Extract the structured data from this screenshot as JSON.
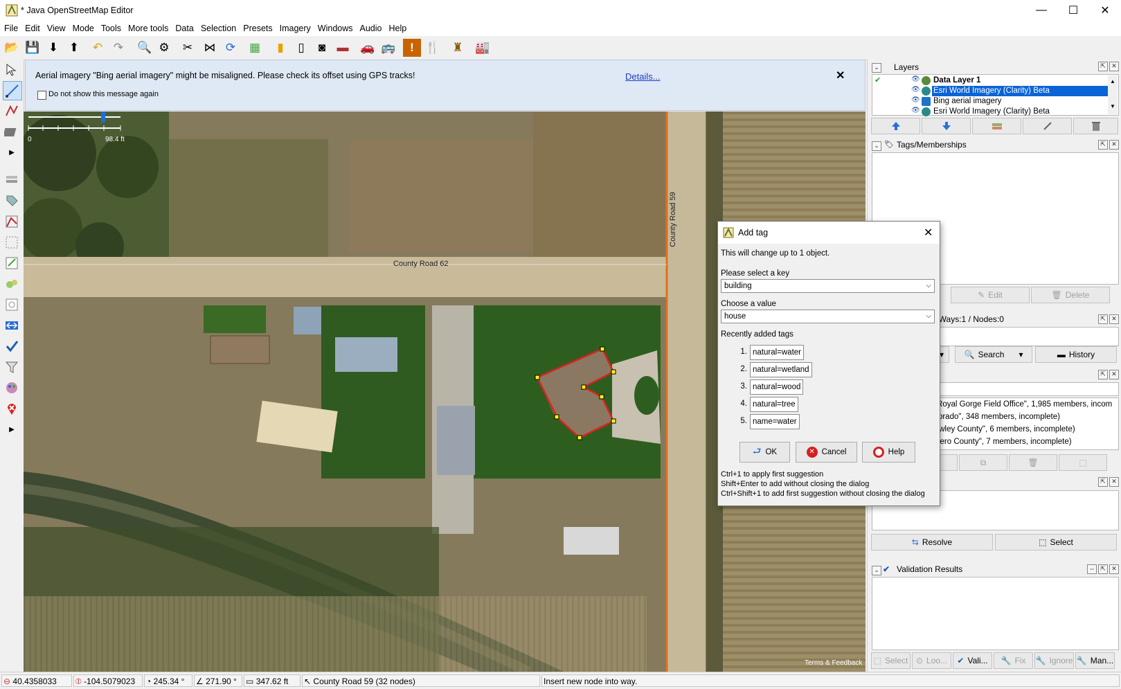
{
  "window": {
    "title": "* Java OpenStreetMap Editor",
    "controls": {
      "minimize": "—",
      "maximize": "☐",
      "close": "✕"
    }
  },
  "menu": [
    "File",
    "Edit",
    "View",
    "Mode",
    "Tools",
    "More tools",
    "Data",
    "Selection",
    "Presets",
    "Imagery",
    "Windows",
    "Audio",
    "Help"
  ],
  "toolbar_icons": [
    "open-file-icon",
    "save-icon",
    "download-icon",
    "upload-icon",
    "undo-icon",
    "redo-icon",
    "zoom-icon",
    "preferences-icon",
    "split-way-icon",
    "combine-icon",
    "update-icon",
    "wireframe-icon",
    "preset-traffic-icon",
    "preset-pole-icon",
    "preset-signal-icon",
    "preset-barrier-icon",
    "preset-car-icon",
    "preset-bus-icon",
    "preset-warning-icon",
    "preset-restaurant-icon",
    "preset-castle-icon",
    "preset-industry-icon"
  ],
  "notification": {
    "message": "Aerial imagery \"Bing aerial imagery\" might be misaligned. Please check its offset using GPS tracks!",
    "details_link": "Details...",
    "checkbox_label": "Do not show this message again",
    "close": "✕"
  },
  "map": {
    "scale_start": "0",
    "scale_end": "98.4 ft",
    "road_label_horizontal": "County Road 62",
    "road_label_vertical": "County Road 59",
    "attribution": "Terms & Feedback"
  },
  "colors": {
    "selection_way": "#e02020",
    "node": "#ffff00",
    "road_line": "#e0701c",
    "layer_selected": "#0a64d6"
  },
  "layers_panel": {
    "title": "Layers",
    "items": [
      {
        "name": "Data Layer 1",
        "bold": true,
        "selected": false
      },
      {
        "name": "Esri World Imagery (Clarity) Beta",
        "bold": false,
        "selected": true
      },
      {
        "name": "Bing aerial imagery",
        "bold": false,
        "selected": false
      },
      {
        "name": "Esri World Imagery (Clarity) Beta",
        "bold": false,
        "selected": false
      }
    ]
  },
  "tags_panel": {
    "title": "Tags/Memberships",
    "edit_label": "Edit",
    "delete_label": "Delete"
  },
  "selection_panel": {
    "title_partial": "/ Ways:1 / Nodes:0",
    "search_label": "Search",
    "history_label": "History"
  },
  "relations_panel": {
    "title_partial": "3",
    "items": [
      "- Royal Gorge Field Office\", 1,985 members, incom",
      "olorado\", 348 members, incomplete)",
      "rowley County\", 6 members, incomplete)",
      "Dtero County\", 7 members, incomplete)"
    ]
  },
  "conflict_panel": {
    "resolve_label": "Resolve",
    "select_label": "Select"
  },
  "validation_panel": {
    "title": "Validation Results",
    "buttons": [
      "Select",
      "Loo...",
      "Vali...",
      "Fix",
      "Ignore",
      "Man..."
    ]
  },
  "dialog": {
    "title": "Add tag",
    "info": "This will change up to 1 object.",
    "key_label": "Please select a key",
    "key_value": "building",
    "value_label": "Choose a value",
    "value_value": "house",
    "recent_label": "Recently added tags",
    "recent_tags": [
      {
        "num": "1.",
        "tag": "natural=water"
      },
      {
        "num": "2.",
        "tag": "natural=wetland"
      },
      {
        "num": "3.",
        "tag": "natural=wood"
      },
      {
        "num": "4.",
        "tag": "natural=tree"
      },
      {
        "num": "5.",
        "tag": "name=water"
      }
    ],
    "ok_label": "OK",
    "cancel_label": "Cancel",
    "help_label": "Help",
    "hints": [
      "Ctrl+1 to apply first suggestion",
      "Shift+Enter to add without closing the dialog",
      "Ctrl+Shift+1 to add first suggestion without closing the dialog"
    ],
    "close": "✕"
  },
  "status": {
    "lat": "40.4358033",
    "lon": "-104.5079023",
    "heading": "245.34 °",
    "angle": "271.90 °",
    "distance": "347.62 ft",
    "way_info": "County Road 59 (32 nodes)",
    "help": "Insert new node into way."
  }
}
